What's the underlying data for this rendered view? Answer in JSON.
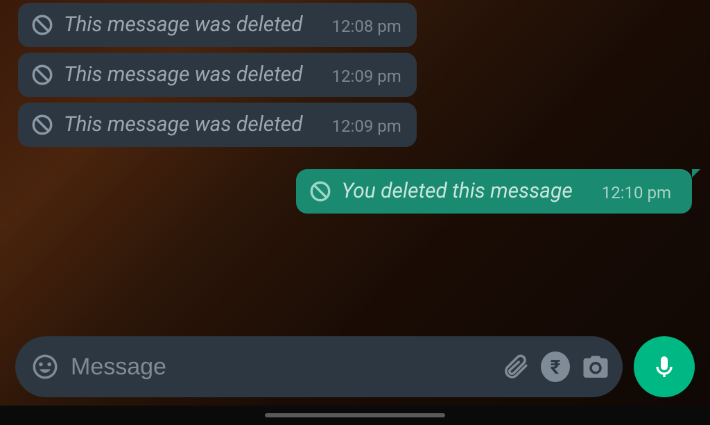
{
  "messages": [
    {
      "direction": "incoming",
      "text": "This message was deleted",
      "time": "12:08 pm"
    },
    {
      "direction": "incoming",
      "text": "This message was deleted",
      "time": "12:09 pm"
    },
    {
      "direction": "incoming",
      "text": "This message was deleted",
      "time": "12:09 pm"
    },
    {
      "direction": "outgoing",
      "text": "You deleted this message",
      "time": "12:10 pm"
    }
  ],
  "input": {
    "placeholder": "Message",
    "value": ""
  },
  "icons": {
    "emoji": "emoji-icon",
    "attach": "attach-icon",
    "rupee": "₹",
    "camera": "camera-icon",
    "mic": "mic-icon",
    "prohibit": "prohibit-icon"
  },
  "colors": {
    "incoming_bubble": "#2d3741",
    "outgoing_bubble": "#1a8a71",
    "fab": "#00b883"
  }
}
